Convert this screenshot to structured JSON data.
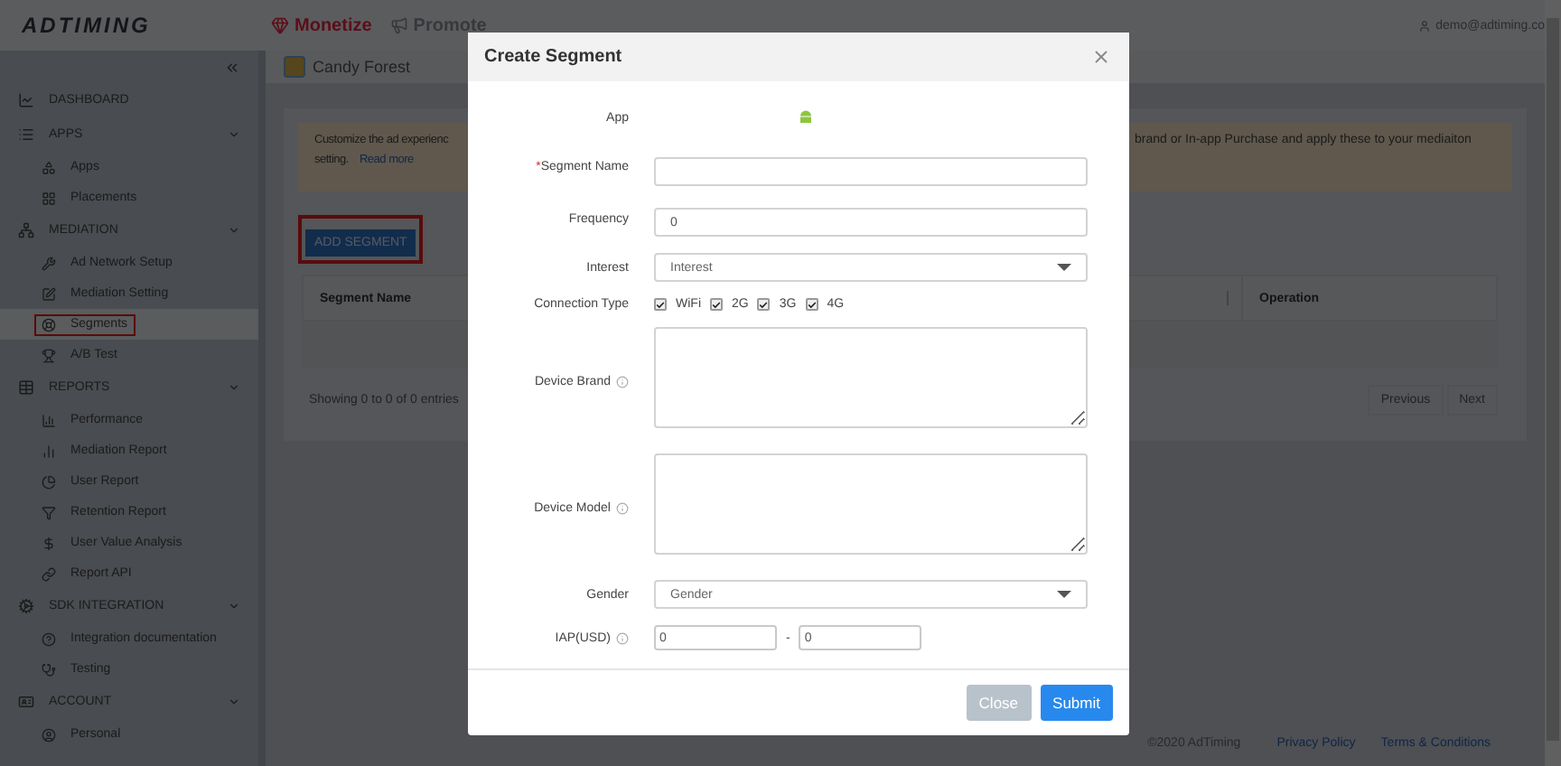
{
  "header": {
    "logo": "ADTIMING",
    "nav": [
      {
        "label": "Monetize",
        "selected": true
      },
      {
        "label": "Promote",
        "selected": false
      }
    ],
    "user": "demo@adtiming.co"
  },
  "sidebar": {
    "items": [
      {
        "kind": "link",
        "label": "DASHBOARD"
      },
      {
        "kind": "group",
        "label": "APPS",
        "expanded": true,
        "children": [
          {
            "label": "Apps",
            "selected": false,
            "highlighted": false
          },
          {
            "label": "Placements",
            "selected": false,
            "highlighted": false
          }
        ]
      },
      {
        "kind": "group",
        "label": "MEDIATION",
        "expanded": true,
        "children": [
          {
            "label": "Ad Network Setup",
            "selected": false,
            "highlighted": false
          },
          {
            "label": "Mediation Setting",
            "selected": false,
            "highlighted": false
          },
          {
            "label": "Segments",
            "selected": true,
            "highlighted": true
          },
          {
            "label": "A/B Test",
            "selected": false,
            "highlighted": false
          }
        ]
      },
      {
        "kind": "group",
        "label": "REPORTS",
        "expanded": true,
        "children": [
          {
            "label": "Performance",
            "selected": false,
            "highlighted": false
          },
          {
            "label": "Mediation Report",
            "selected": false,
            "highlighted": false
          },
          {
            "label": "User Report",
            "selected": false,
            "highlighted": false
          },
          {
            "label": "Retention Report",
            "selected": false,
            "highlighted": false
          },
          {
            "label": "User Value Analysis",
            "selected": false,
            "highlighted": false
          },
          {
            "label": "Report API",
            "selected": false,
            "highlighted": false
          }
        ]
      },
      {
        "kind": "group",
        "label": "SDK INTEGRATION",
        "expanded": true,
        "children": [
          {
            "label": "Integration documentation",
            "selected": false,
            "highlighted": false
          },
          {
            "label": "Testing",
            "selected": false,
            "highlighted": false
          }
        ]
      },
      {
        "kind": "group",
        "label": "ACCOUNT",
        "expanded": true,
        "children": [
          {
            "label": "Personal",
            "selected": false,
            "highlighted": false
          }
        ]
      }
    ]
  },
  "breadcrumb": {
    "app": "Candy Forest"
  },
  "notice": {
    "left_lines": [
      "Customize the ad experienc",
      "setting."
    ],
    "link": "Read more",
    "right": "brand or In-app Purchase and apply these to your mediaiton"
  },
  "add_button": {
    "label": "ADD SEGMENT",
    "highlighted": true
  },
  "table": {
    "columns": [
      "Segment Name",
      "Operation"
    ]
  },
  "table_footer": {
    "info": "Showing 0 to 0 of 0 entries",
    "pager": [
      "Previous",
      "Next"
    ]
  },
  "page_footer": {
    "copyright": "©2020 AdTiming",
    "links": [
      "Privacy Policy",
      "Terms & Conditions"
    ]
  },
  "modal": {
    "title": "Create Segment",
    "fields": [
      {
        "kind": "app",
        "label": "App"
      },
      {
        "kind": "text",
        "label": "Segment Name",
        "required_mark": "*"
      },
      {
        "kind": "text",
        "label": "Frequency",
        "value": "0"
      },
      {
        "kind": "select",
        "label": "Interest",
        "placeholder": "Interest"
      },
      {
        "kind": "checks",
        "label": "Connection Type",
        "options": [
          {
            "label": "WiFi",
            "checked": true
          },
          {
            "label": "2G",
            "checked": true
          },
          {
            "label": "3G",
            "checked": true
          },
          {
            "label": "4G",
            "checked": true
          }
        ]
      },
      {
        "kind": "textarea",
        "label": "Device Brand",
        "info": true
      },
      {
        "kind": "textarea",
        "label": "Device Model",
        "info": true
      },
      {
        "kind": "select",
        "label": "Gender",
        "placeholder": "Gender"
      },
      {
        "kind": "range",
        "label": "IAP(USD)",
        "info": true,
        "from": "0",
        "separator": "-",
        "to": "0"
      }
    ],
    "buttons": [
      {
        "label": "Close",
        "kind": "secondary"
      },
      {
        "label": "Submit",
        "kind": "primary"
      }
    ]
  }
}
